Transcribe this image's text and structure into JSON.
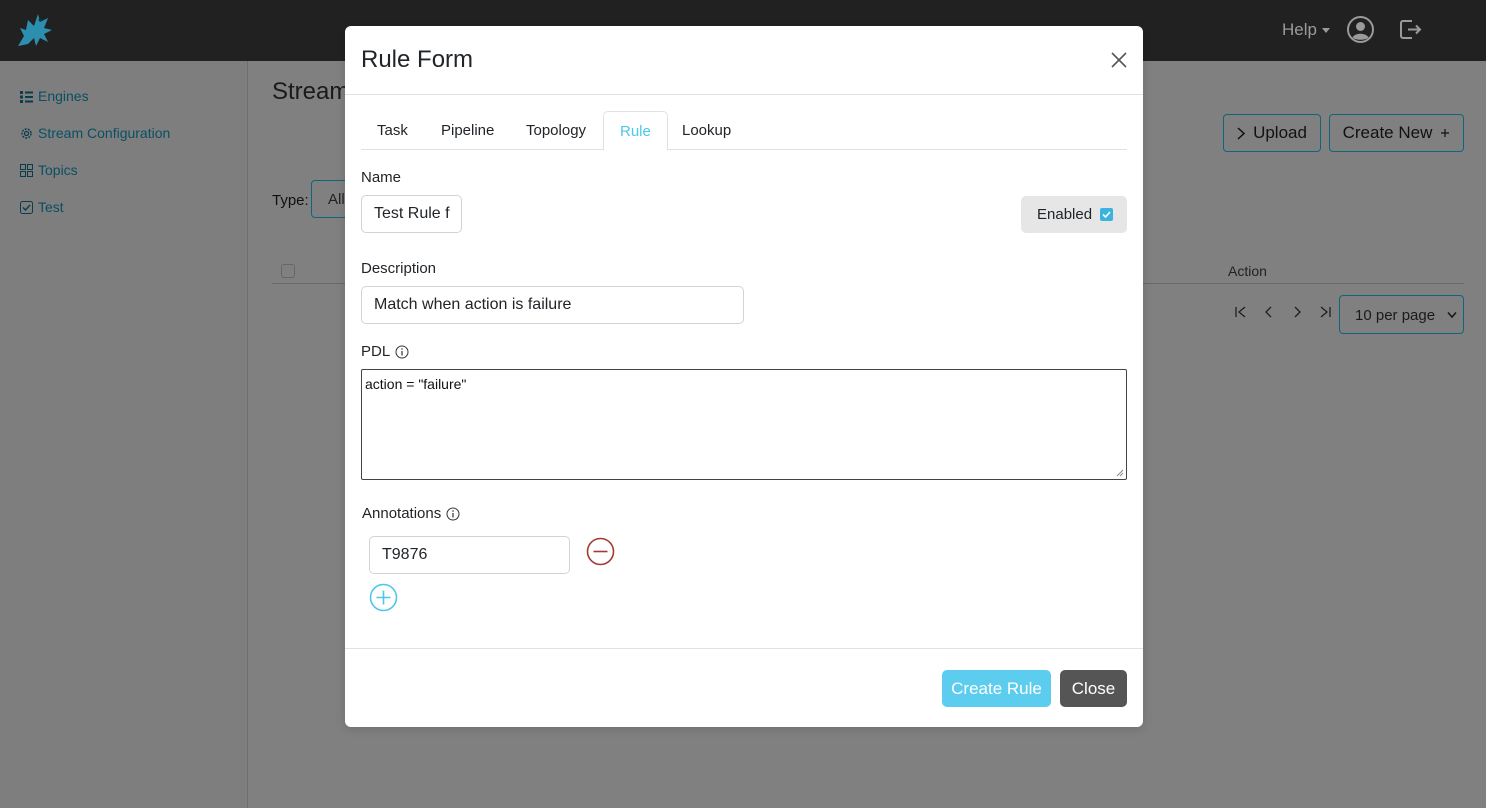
{
  "app": {
    "help_label": "Help",
    "logo_icon": "dragon-logo-icon",
    "accent_color": "#4dc8e9"
  },
  "sidebar": {
    "items": [
      {
        "label": "Engines",
        "icon": "list-icon"
      },
      {
        "label": "Stream Configuration",
        "icon": "gear-icon"
      },
      {
        "label": "Topics",
        "icon": "grid-icon"
      },
      {
        "label": "Test",
        "icon": "check-square-icon"
      }
    ]
  },
  "page": {
    "title": "Stream",
    "upload_label": "Upload",
    "create_new_label": "Create New",
    "type_label": "Type:",
    "type_value": "All",
    "action_header": "Action",
    "per_page": "10 per page"
  },
  "modal": {
    "title": "Rule Form",
    "tabs": [
      {
        "label": "Task"
      },
      {
        "label": "Pipeline"
      },
      {
        "label": "Topology"
      },
      {
        "label": "Rule"
      },
      {
        "label": "Lookup"
      }
    ],
    "active_tab": "Rule",
    "name_label": "Name",
    "name_value": "Test Rule f",
    "enabled_label": "Enabled",
    "enabled_checked": true,
    "description_label": "Description",
    "description_value": "Match when action is failure",
    "pdl_label": "PDL",
    "pdl_value": "action = \"failure\"",
    "annotations_label": "Annotations",
    "annotations": [
      "T9876"
    ],
    "create_label": "Create Rule",
    "close_label": "Close",
    "remove_color": "#a23b32",
    "add_color": "#4dc8e9"
  }
}
